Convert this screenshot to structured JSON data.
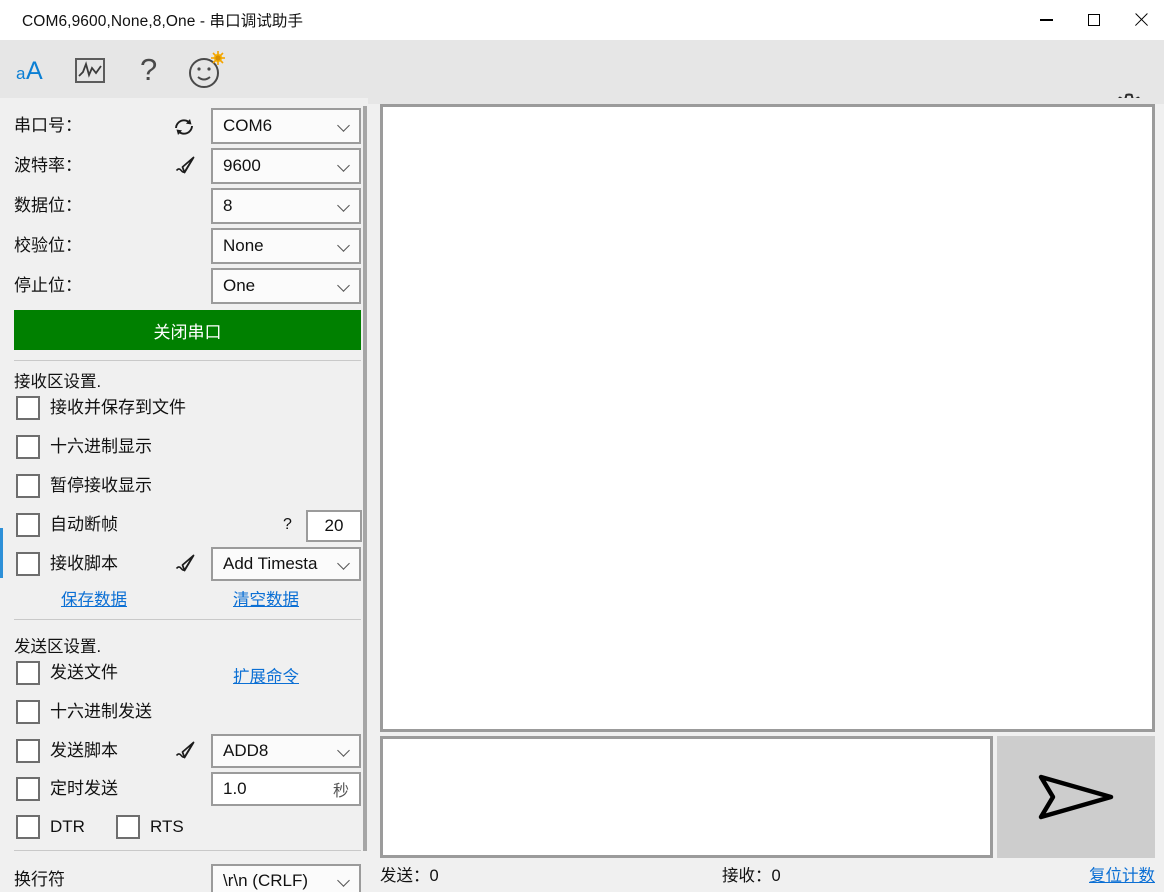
{
  "window": {
    "title": "COM6,9600,None,8,One - 串口调试助手",
    "minimize": "minimize-icon",
    "maximize": "maximize-icon",
    "close": "close-icon"
  },
  "toolbar": {
    "items": [
      {
        "name": "font-size-icon",
        "label": "aA"
      },
      {
        "name": "waveform-icon",
        "label": ""
      },
      {
        "name": "help-icon",
        "label": "?"
      },
      {
        "name": "smiley-icon",
        "label": ""
      }
    ],
    "settings_label": "gear-icon"
  },
  "serial": {
    "rows": [
      {
        "label": "串口号：",
        "value": "COM6",
        "icon": "refresh-icon"
      },
      {
        "label": "波特率：",
        "value": "9600",
        "icon": "pen-icon"
      },
      {
        "label": "数据位：",
        "value": "8",
        "icon": ""
      },
      {
        "label": "校验位：",
        "value": "None",
        "icon": ""
      },
      {
        "label": "停止位：",
        "value": "One",
        "icon": ""
      }
    ],
    "toggle_button": "关闭串口",
    "toggle_color": "#008000"
  },
  "receive": {
    "section_title": "接收区设置.",
    "checkboxes": [
      {
        "label": "接收并保存到文件",
        "checked": false
      },
      {
        "label": "十六进制显示",
        "checked": false
      },
      {
        "label": "暂停接收显示",
        "checked": false
      },
      {
        "label": "自动断帧",
        "checked": false
      },
      {
        "label": "接收脚本",
        "checked": false
      }
    ],
    "frame_hint": "?",
    "frame_timeout": "20",
    "script_value": "Add Timesta",
    "save_link": "保存数据",
    "clear_link": "清空数据"
  },
  "send": {
    "section_title": "发送区设置.",
    "checkboxes": [
      {
        "label": "发送文件",
        "checked": false
      },
      {
        "label": "十六进制发送",
        "checked": false
      },
      {
        "label": "发送脚本",
        "checked": false
      },
      {
        "label": "定时发送",
        "checked": false
      }
    ],
    "expand_link": "扩展命令",
    "script_value": "ADD8",
    "interval_value": "1.0",
    "interval_unit": "秒",
    "dtr_label": "DTR",
    "rts_label": "RTS",
    "newline_label": "换行符",
    "newline_value": "\\r\\n (CRLF)"
  },
  "main": {
    "receive_text": "",
    "send_text": "",
    "send_button_icon": "send-paper-plane-icon"
  },
  "status": {
    "sent_label": "发送：0",
    "received_label": "接收：0",
    "reset_link": "复位计数"
  },
  "colors": {
    "accent": "#0b7fd4",
    "link": "#0b6fd4",
    "green": "#008000",
    "toolbar_bg": "#e6e6e6",
    "panel_bg": "#f0f0f0",
    "border": "#9b9b9b"
  }
}
